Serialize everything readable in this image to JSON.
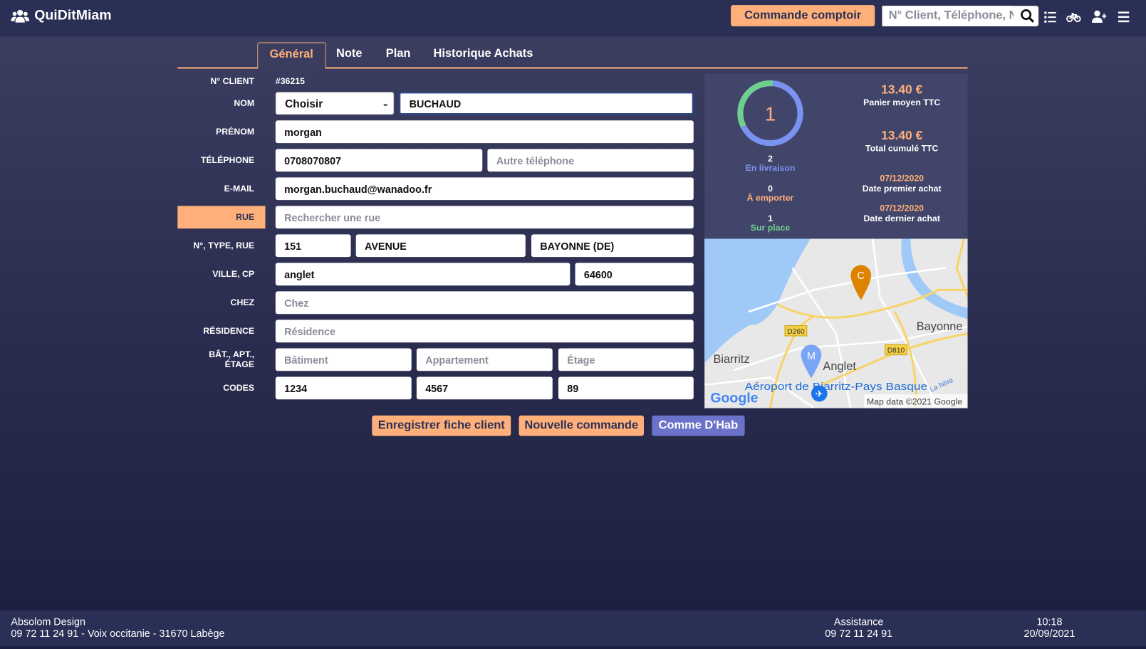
{
  "header": {
    "app_name": "QuiDitMiam",
    "counter_order_label": "Commande comptoir",
    "search_placeholder": "N° Client, Téléphone, Nom",
    "icons": [
      "users-icon",
      "search-icon",
      "list-icon",
      "bicycle-icon",
      "user-plus-icon",
      "menu-icon"
    ]
  },
  "tabs": [
    {
      "label": "Général",
      "active": true
    },
    {
      "label": "Note"
    },
    {
      "label": "Plan"
    },
    {
      "label": "Historique Achats"
    }
  ],
  "form": {
    "client_no": {
      "label": "N° CLIENT",
      "value": "#36215"
    },
    "nom": {
      "label": "NOM",
      "civility": "Choisir",
      "value": "BUCHAUD"
    },
    "prenom": {
      "label": "PRÉNOM",
      "value": "morgan"
    },
    "telephone": {
      "label": "TÉLÉPHONE",
      "value": "0708070807",
      "other_placeholder": "Autre téléphone"
    },
    "email": {
      "label": "E-MAIL",
      "value": "morgan.buchaud@wanadoo.fr"
    },
    "rue": {
      "label": "RUE",
      "placeholder": "Rechercher une rue"
    },
    "address": {
      "label": "N°, TYPE, RUE",
      "number": "151",
      "type": "AVENUE",
      "street": "BAYONNE (DE)"
    },
    "ville": {
      "label": "VILLE, CP",
      "city": "anglet",
      "cp": "64600"
    },
    "chez": {
      "label": "CHEZ",
      "placeholder": "Chez"
    },
    "residence": {
      "label": "RÉSIDENCE",
      "placeholder": "Résidence"
    },
    "bat": {
      "label": "BÂT., APT., ÉTAGE",
      "batiment_placeholder": "Bâtiment",
      "appartement_placeholder": "Appartement",
      "etage_placeholder": "Étage"
    },
    "codes": {
      "label": "CODES",
      "values": [
        "1234",
        "4567",
        "89"
      ]
    }
  },
  "stats": {
    "total_orders": "1",
    "donut_colors": {
      "livraison": "#7b93f0",
      "sur_place": "#6fcf8e"
    },
    "livraison": {
      "count": "2",
      "label": "En livraison",
      "color": "#7b93f0"
    },
    "emporter": {
      "count": "0",
      "label": "À emporter",
      "color": "#ffb07a"
    },
    "sur_place": {
      "count": "1",
      "label": "Sur place",
      "color": "#6fcf8e"
    },
    "panier_moyen": {
      "value": "13.40 €",
      "label": "Panier moyen TTC"
    },
    "total_cumule": {
      "value": "13.40 €",
      "label": "Total cumulé TTC"
    },
    "premier_achat": {
      "value": "07/12/2020",
      "label": "Date premier achat"
    },
    "dernier_achat": {
      "value": "07/12/2020",
      "label": "Date dernier achat"
    }
  },
  "map": {
    "labels": [
      "Bayonne",
      "Biarritz",
      "Anglet",
      "Aéroport de Biarritz-Pays Basque",
      "D260",
      "D810",
      "La Nive"
    ],
    "markers": [
      "C",
      "M"
    ],
    "google": "Google",
    "attribution": "Map data ©2021 Google"
  },
  "actions": {
    "save": "Enregistrer fiche client",
    "new_order": "Nouvelle commande",
    "usual": "Comme D'Hab"
  },
  "footer": {
    "company": "Absolom Design",
    "company_info": "09 72 11 24 91 - Voix occitanie - 31670 Labège",
    "assistance_label": "Assistance",
    "assistance_phone": "09 72 11 24 91",
    "time": "10:18",
    "date": "20/09/2021"
  }
}
